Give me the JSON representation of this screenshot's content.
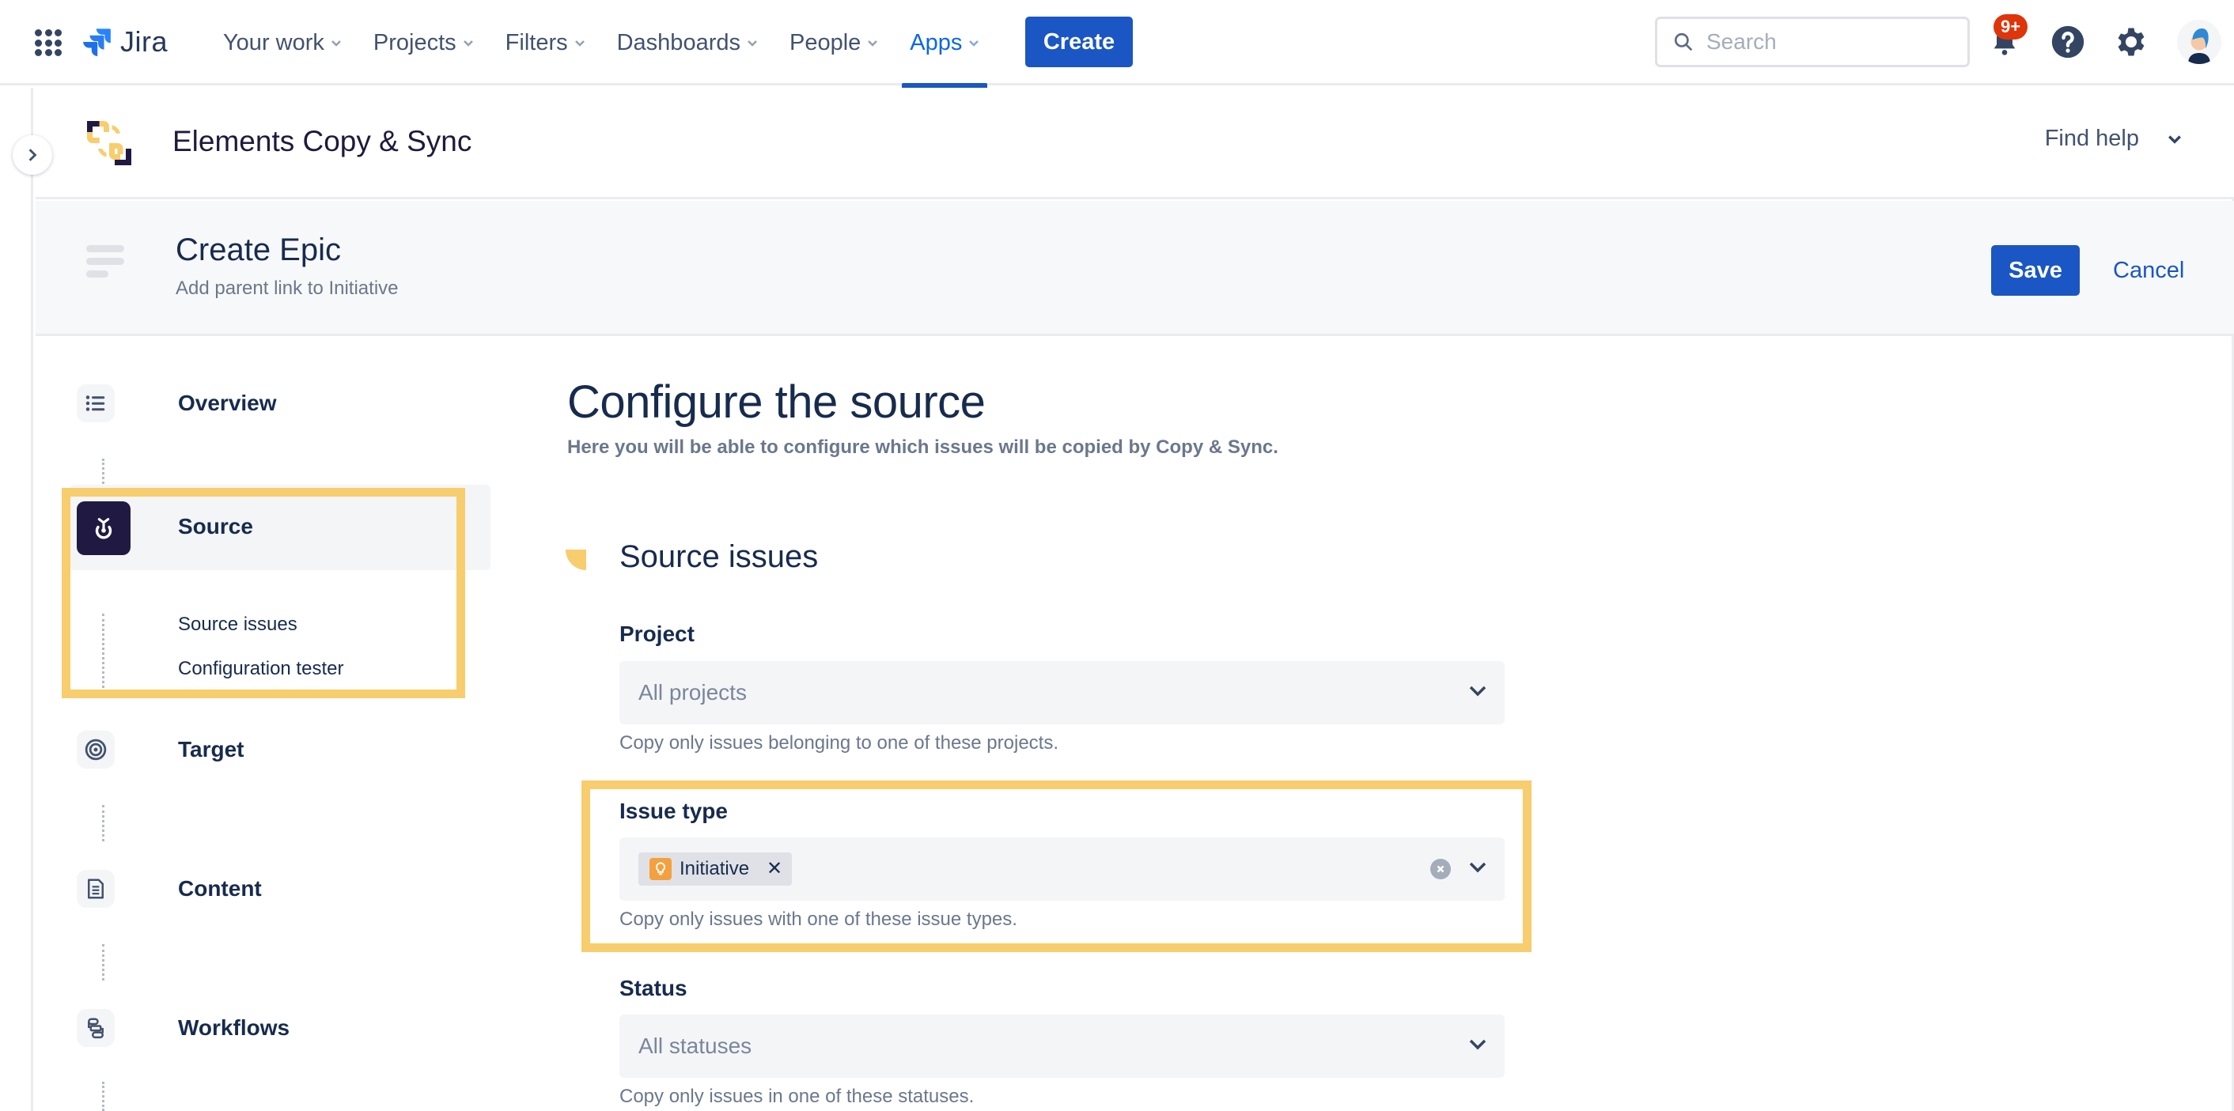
{
  "topnav": {
    "product_name": "Jira",
    "items": [
      {
        "label": "Your work",
        "active": false
      },
      {
        "label": "Projects",
        "active": false
      },
      {
        "label": "Filters",
        "active": false
      },
      {
        "label": "Dashboards",
        "active": false
      },
      {
        "label": "People",
        "active": false
      },
      {
        "label": "Apps",
        "active": true
      }
    ],
    "create_label": "Create",
    "search_placeholder": "Search",
    "notification_badge": "9+",
    "icons": [
      "app-switcher-icon",
      "jira-logo-icon",
      "search-icon",
      "bell-icon",
      "help-icon",
      "gear-icon",
      "avatar"
    ]
  },
  "app_header": {
    "title": "Elements Copy & Sync",
    "find_help_label": "Find help"
  },
  "sub_header": {
    "title": "Create Epic",
    "description": "Add parent link to Initiative",
    "save_label": "Save",
    "cancel_label": "Cancel"
  },
  "sidebar": {
    "steps": [
      {
        "label": "Overview",
        "icon": "list-icon"
      },
      {
        "label": "Source",
        "icon": "source-icon",
        "active": true,
        "children": [
          {
            "label": "Source issues"
          },
          {
            "label": "Configuration tester"
          }
        ]
      },
      {
        "label": "Target",
        "icon": "target-icon"
      },
      {
        "label": "Content",
        "icon": "document-icon"
      },
      {
        "label": "Workflows",
        "icon": "workflow-icon"
      }
    ]
  },
  "main": {
    "title": "Configure the source",
    "description": "Here you will be able to configure which issues will be copied by Copy & Sync.",
    "section_title": "Source issues",
    "fields": {
      "project": {
        "label": "Project",
        "placeholder": "All projects",
        "helper": "Copy only issues belonging to one of these projects."
      },
      "issue_type": {
        "label": "Issue type",
        "selected": [
          {
            "label": "Initiative",
            "icon": "lightbulb-icon",
            "color": "#f4a03e"
          }
        ],
        "helper": "Copy only issues with one of these issue types."
      },
      "status": {
        "label": "Status",
        "placeholder": "All statuses",
        "helper": "Copy only issues in one of these statuses."
      }
    }
  },
  "colors": {
    "brand_blue": "#1a56c4",
    "highlight": "#f8cd6e",
    "active_icon_bg": "#201a42",
    "badge_red": "#de350b"
  }
}
